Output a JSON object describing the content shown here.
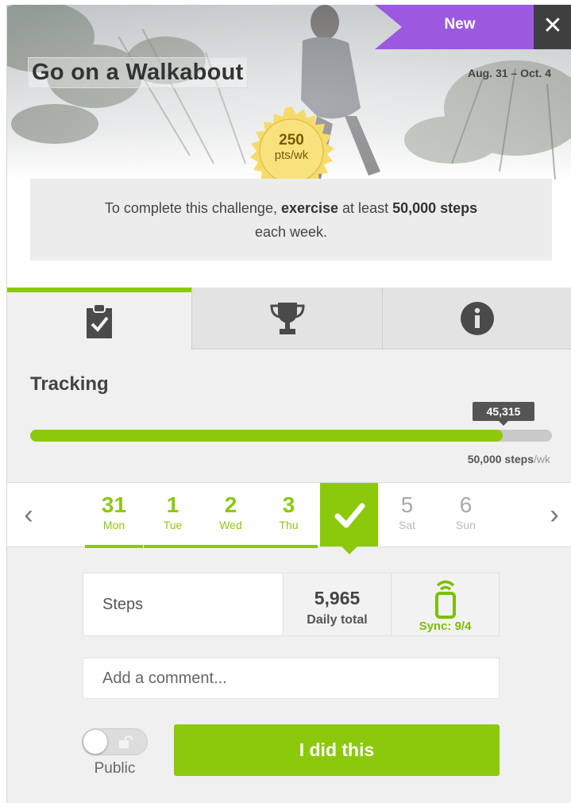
{
  "header": {
    "title": "Go on a Walkabout",
    "dates": "Aug. 31 – Oct. 4",
    "new_badge": "New",
    "close_symbol": "✕"
  },
  "reward": {
    "points": "250",
    "unit": "pts/wk",
    "color": "#f5dc6a"
  },
  "description": {
    "before": "To complete this challenge, ",
    "bold1": "exercise",
    "middle": " at least ",
    "bold2": "50,000 steps",
    "after": " each week."
  },
  "tabs": [
    {
      "icon": "clipboard-check-icon",
      "active": true
    },
    {
      "icon": "trophy-icon",
      "active": false
    },
    {
      "icon": "info-icon",
      "active": false
    }
  ],
  "tracking": {
    "title": "Tracking",
    "current_steps": "45,315",
    "goal_value": "50,000 steps",
    "goal_unit": "/wk",
    "progress_fraction": 0.906
  },
  "days": {
    "prev_arrow": "‹",
    "next_arrow": "›",
    "items": [
      {
        "num": "31",
        "name": "Mon",
        "state": "done"
      },
      {
        "num": "1",
        "name": "Tue",
        "state": "done"
      },
      {
        "num": "2",
        "name": "Wed",
        "state": "done"
      },
      {
        "num": "3",
        "name": "Thu",
        "state": "done"
      },
      {
        "num": "",
        "name": "",
        "state": "today"
      },
      {
        "num": "5",
        "name": "Sat",
        "state": "future"
      },
      {
        "num": "6",
        "name": "Sun",
        "state": "future"
      }
    ]
  },
  "entry": {
    "label": "Steps",
    "daily_value": "5,965",
    "daily_label": "Daily total",
    "sync_label": "Sync: 9/4"
  },
  "comment": {
    "placeholder": "Add a comment..."
  },
  "privacy": {
    "label": "Public"
  },
  "action": {
    "button_label": "I did this"
  },
  "colors": {
    "accent": "#8cc90c",
    "ribbon": "#9b59e0",
    "dark": "#3f3f3f"
  }
}
